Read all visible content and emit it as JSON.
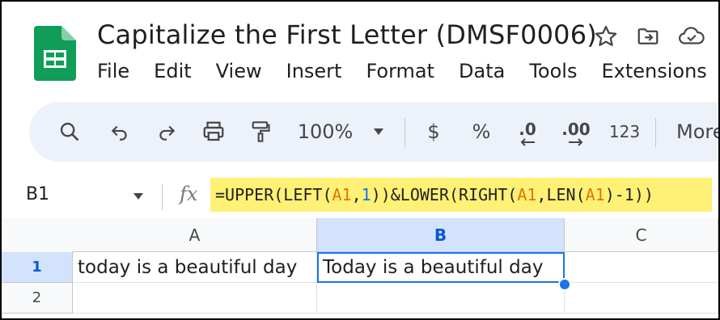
{
  "document": {
    "title": "Capitalize the First Letter (DMSF0006)"
  },
  "menu": [
    "File",
    "Edit",
    "View",
    "Insert",
    "Format",
    "Data",
    "Tools",
    "Extensions"
  ],
  "toolbar": {
    "zoom": "100%",
    "currency": "$",
    "percent": "%",
    "decrease_decimal": ".0",
    "increase_decimal": ".00",
    "number_format": "123",
    "more": "More"
  },
  "formula_bar": {
    "name_box": "B1",
    "fx": "fx",
    "formula_parts": {
      "p1": "=UPPER(LEFT(",
      "r1": "A1",
      "p2": ",",
      "n1": "1",
      "p3": "))&LOWER(RIGHT(",
      "r2": "A1",
      "p4": ",LEN(",
      "r3": "A1",
      "p5": ")-1))"
    }
  },
  "grid": {
    "columns": [
      "A",
      "B",
      "C"
    ],
    "selected_column": "B",
    "rows": [
      "1",
      "2"
    ],
    "selected_row": "1",
    "cells": {
      "A1": "today is a beautiful day",
      "B1": "Today is a beautiful day"
    }
  },
  "colors": {
    "formula_highlight": "#fff176",
    "cell_reference": "#e37400",
    "selection": "#1a73e8",
    "sheets_green": "#0f9d58"
  }
}
